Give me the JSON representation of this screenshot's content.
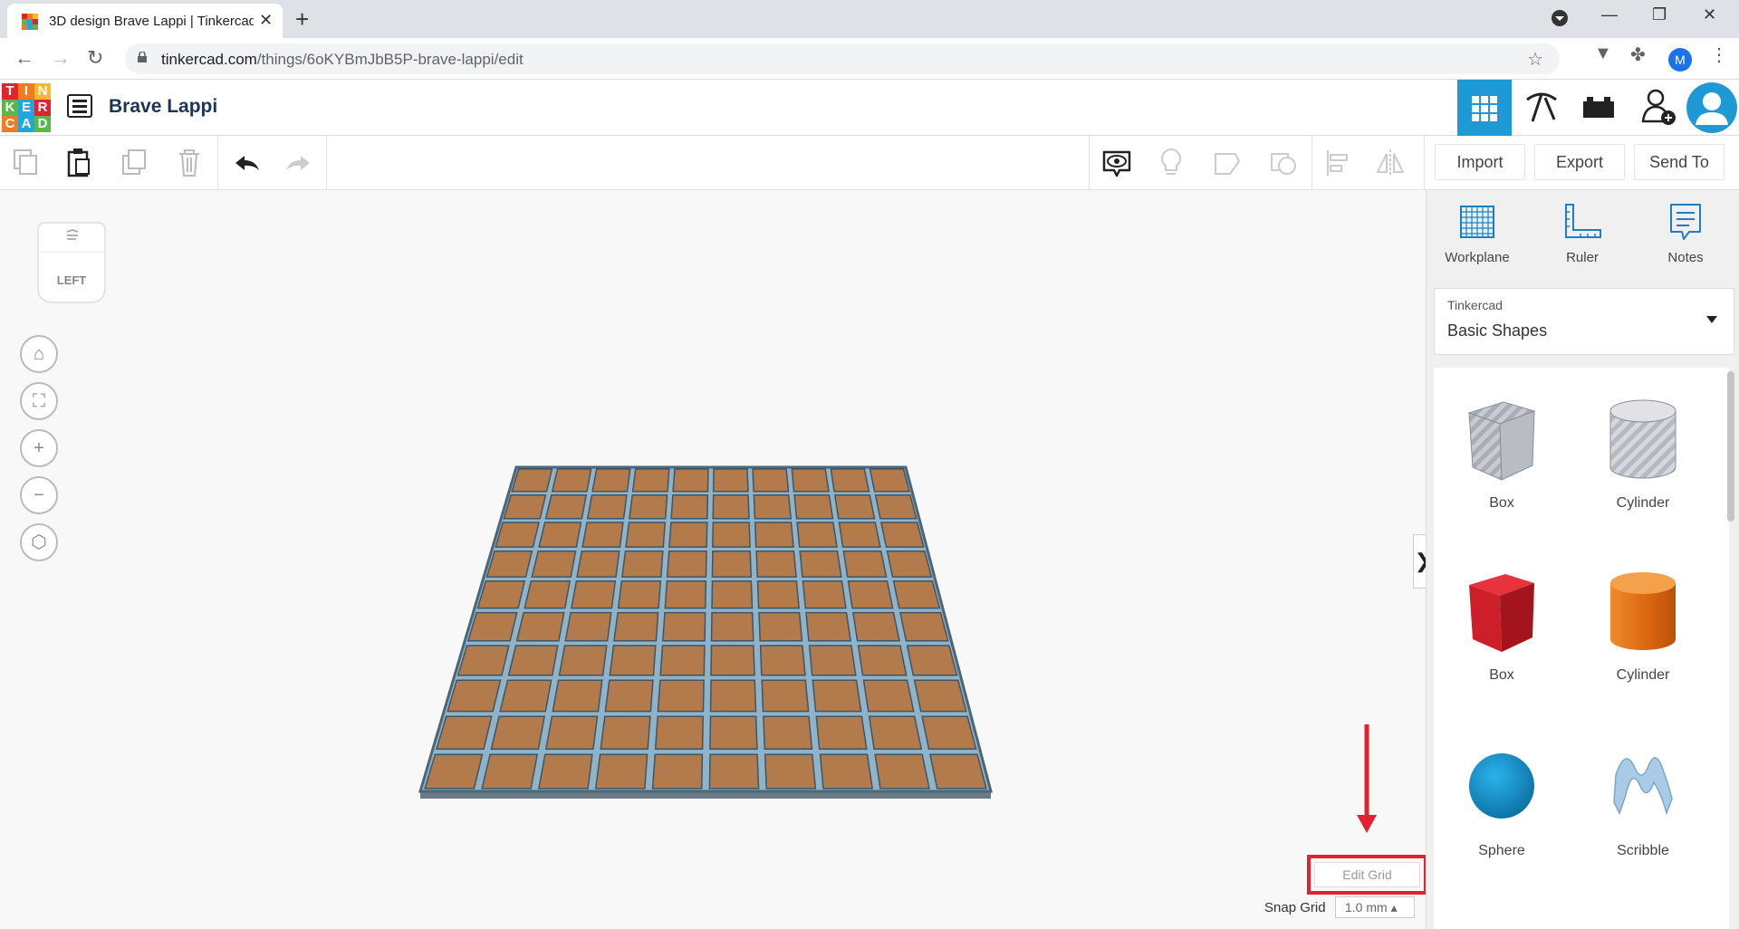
{
  "browser": {
    "tab_title": "3D design Brave Lappi | Tinkercad",
    "url_host": "tinkercad.com",
    "url_path": "/things/6oKYBmJbB5P-brave-lappi/edit",
    "profile_initial": "M"
  },
  "app": {
    "logo_letters": [
      "T",
      "I",
      "N",
      "K",
      "E",
      "R",
      "C",
      "A",
      "D"
    ],
    "logo_colors": [
      "#e2232f",
      "#f47a20",
      "#fcb72b",
      "#5ab946",
      "#1fa8e0",
      "#e2232f",
      "#f47a20",
      "#1fa8e0",
      "#5ab946"
    ],
    "design_title": "Brave Lappi"
  },
  "toolbar": {
    "import_label": "Import",
    "export_label": "Export",
    "send_to_label": "Send To"
  },
  "viewport": {
    "viewcube_label": "LEFT",
    "edit_grid_label": "Edit Grid",
    "snap_grid_label": "Snap Grid",
    "snap_grid_value": "1.0 mm ▴",
    "grid_rows": 10,
    "grid_cols": 10,
    "highlight_color": "#e2232f",
    "tile_color": "#b37a4c"
  },
  "panel": {
    "workplane_label": "Workplane",
    "ruler_label": "Ruler",
    "notes_label": "Notes",
    "library_small": "Tinkercad",
    "library_name": "Basic Shapes",
    "shapes": [
      {
        "label": "Box"
      },
      {
        "label": "Cylinder"
      },
      {
        "label": "Box"
      },
      {
        "label": "Cylinder"
      },
      {
        "label": "Sphere"
      },
      {
        "label": "Scribble"
      }
    ]
  }
}
